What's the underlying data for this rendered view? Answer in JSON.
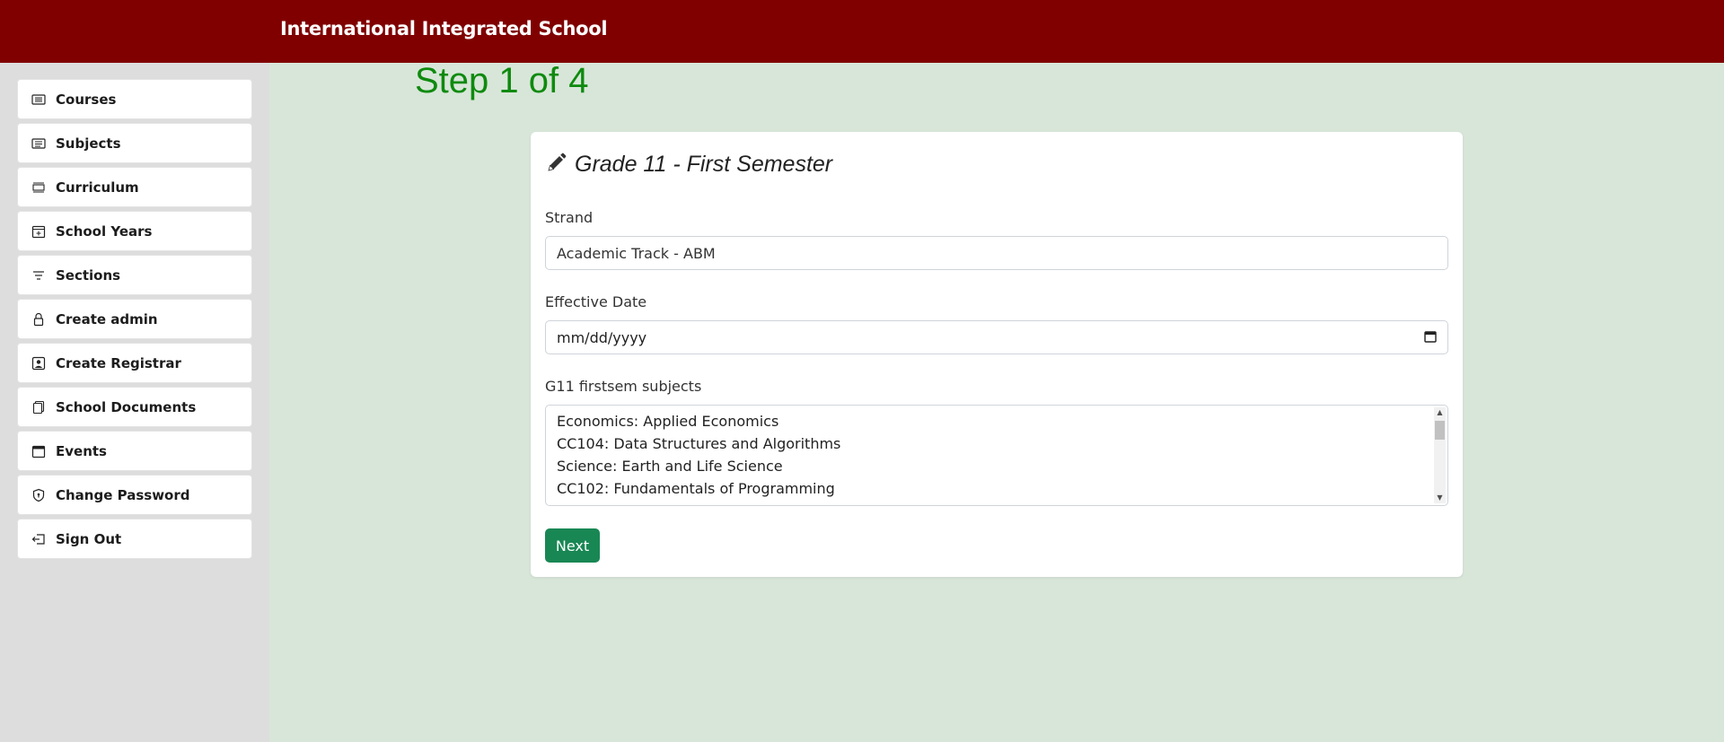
{
  "header": {
    "title": "International Integrated School"
  },
  "sidebar": {
    "items": [
      {
        "label": "Courses",
        "icon": "ticket-icon"
      },
      {
        "label": "Subjects",
        "icon": "list-icon"
      },
      {
        "label": "Curriculum",
        "icon": "layers-icon"
      },
      {
        "label": "School Years",
        "icon": "calendar-plus-icon"
      },
      {
        "label": "Sections",
        "icon": "filter-icon"
      },
      {
        "label": "Create admin",
        "icon": "lock-icon"
      },
      {
        "label": "Create Registrar",
        "icon": "person-badge-icon"
      },
      {
        "label": "School Documents",
        "icon": "documents-icon"
      },
      {
        "label": "Events",
        "icon": "calendar-icon"
      },
      {
        "label": "Change Password",
        "icon": "shield-icon"
      },
      {
        "label": "Sign Out",
        "icon": "sign-out-icon"
      }
    ]
  },
  "main": {
    "step": "Step 1 of 4",
    "form": {
      "title": "Grade 11 - First Semester",
      "strand_label": "Strand",
      "strand_value": "Academic Track - ABM",
      "date_label": "Effective Date",
      "date_placeholder": "mm/dd/yyyy",
      "subjects_label": "G11 firstsem subjects",
      "subjects": [
        "Economics: Applied Economics",
        "CC104: Data Structures and Algorithms",
        "Science: Earth and Life Science",
        "CC102: Fundamentals of Programming"
      ],
      "next_label": "Next"
    }
  },
  "colors": {
    "header": "#800000",
    "sidebar": "#dddddd",
    "background": "#d8e6d9",
    "step": "#0e8a0e",
    "button": "#198754"
  }
}
